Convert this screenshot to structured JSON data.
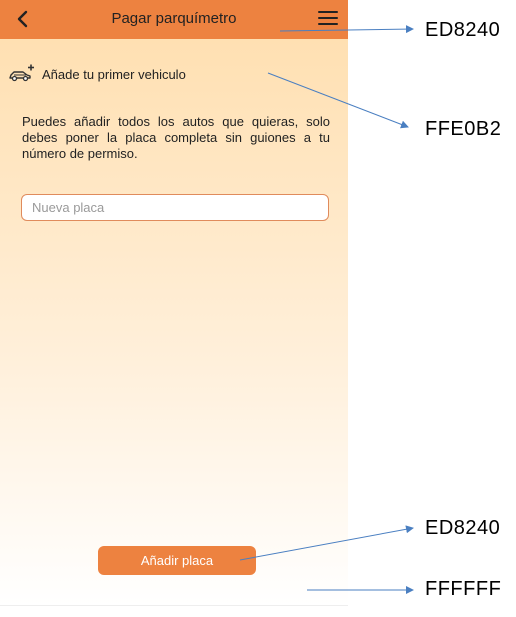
{
  "header": {
    "title": "Pagar parquímetro",
    "back_icon": "chevron-left-icon",
    "menu_icon": "hamburger-menu-icon"
  },
  "vehicle": {
    "icon": "car-add-icon",
    "label": "Añade tu primer vehiculo"
  },
  "description": "Puedes añadir todos los autos que quieras, solo debes poner la placa completa sin guiones a tu número de permiso.",
  "plate_input": {
    "placeholder": "Nueva placa",
    "value": ""
  },
  "add_button": {
    "label": "Añadir placa"
  },
  "annotations": [
    {
      "label": "ED8240"
    },
    {
      "label": "FFE0B2"
    },
    {
      "label": "ED8240"
    },
    {
      "label": "FFFFFF"
    }
  ],
  "colors": {
    "primary": "#ED8240",
    "background_top": "#FFE0B2",
    "background_bottom": "#FFFFFF"
  }
}
